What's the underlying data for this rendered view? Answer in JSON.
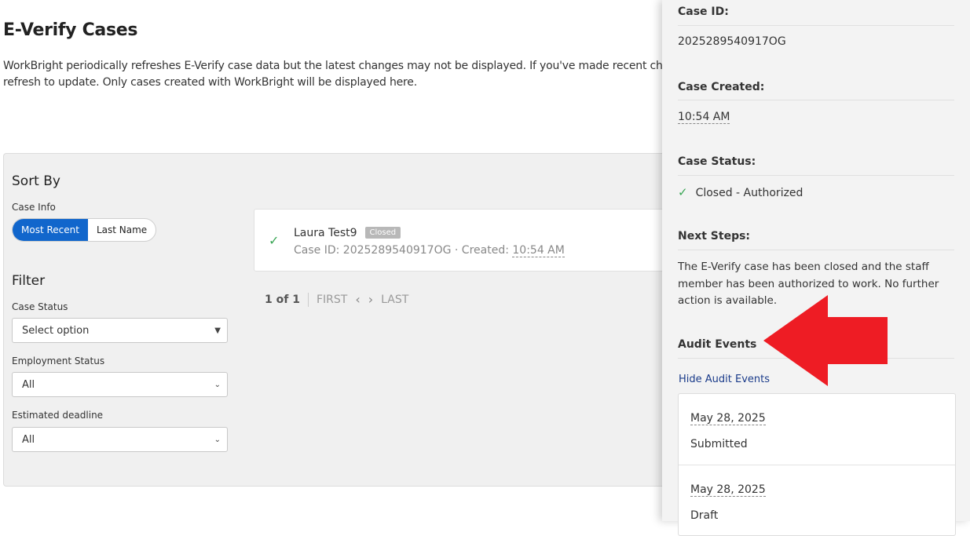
{
  "page": {
    "title": "E-Verify Cases",
    "intro_line1": "WorkBright periodically refreshes E-Verify case data but the latest changes may not be displayed. If you've made recent changes",
    "intro_line2": "refresh to update. Only cases created with WorkBright will be displayed here."
  },
  "sort": {
    "title": "Sort By",
    "case_info_label": "Case Info",
    "options": [
      "Most Recent",
      "Last Name"
    ],
    "selected": "Most Recent"
  },
  "filter": {
    "title": "Filter",
    "case_status": {
      "label": "Case Status",
      "value": "Select option"
    },
    "employment_status": {
      "label": "Employment Status",
      "value": "All"
    },
    "estimated_deadline": {
      "label": "Estimated deadline",
      "value": "All"
    }
  },
  "case_card": {
    "name": "Laura Test9",
    "badge": "Closed",
    "meta_prefix": "Case ID: 2025289540917OG · Created:",
    "created_time": "10:54 AM"
  },
  "pager": {
    "count": "1 of 1",
    "first": "FIRST",
    "last": "LAST"
  },
  "drawer": {
    "case_id_label": "Case ID:",
    "case_id": "2025289540917OG",
    "created_label": "Case Created:",
    "created_value": "10:54 AM",
    "status_label": "Case Status:",
    "status_value": "Closed - Authorized",
    "next_steps_label": "Next Steps:",
    "next_steps_text": "The E-Verify case has been closed and the staff member has been authorized to work. No further action is available.",
    "audit_label": "Audit Events",
    "hide_audit_link": "Hide Audit Events",
    "audit_events": [
      {
        "date": "May 28, 2025",
        "event": "Submitted"
      },
      {
        "date": "May 28, 2025",
        "event": "Draft"
      }
    ]
  },
  "colors": {
    "accent": "#1166cc",
    "success": "#3aa655",
    "annotation_arrow": "#ee1c24"
  }
}
